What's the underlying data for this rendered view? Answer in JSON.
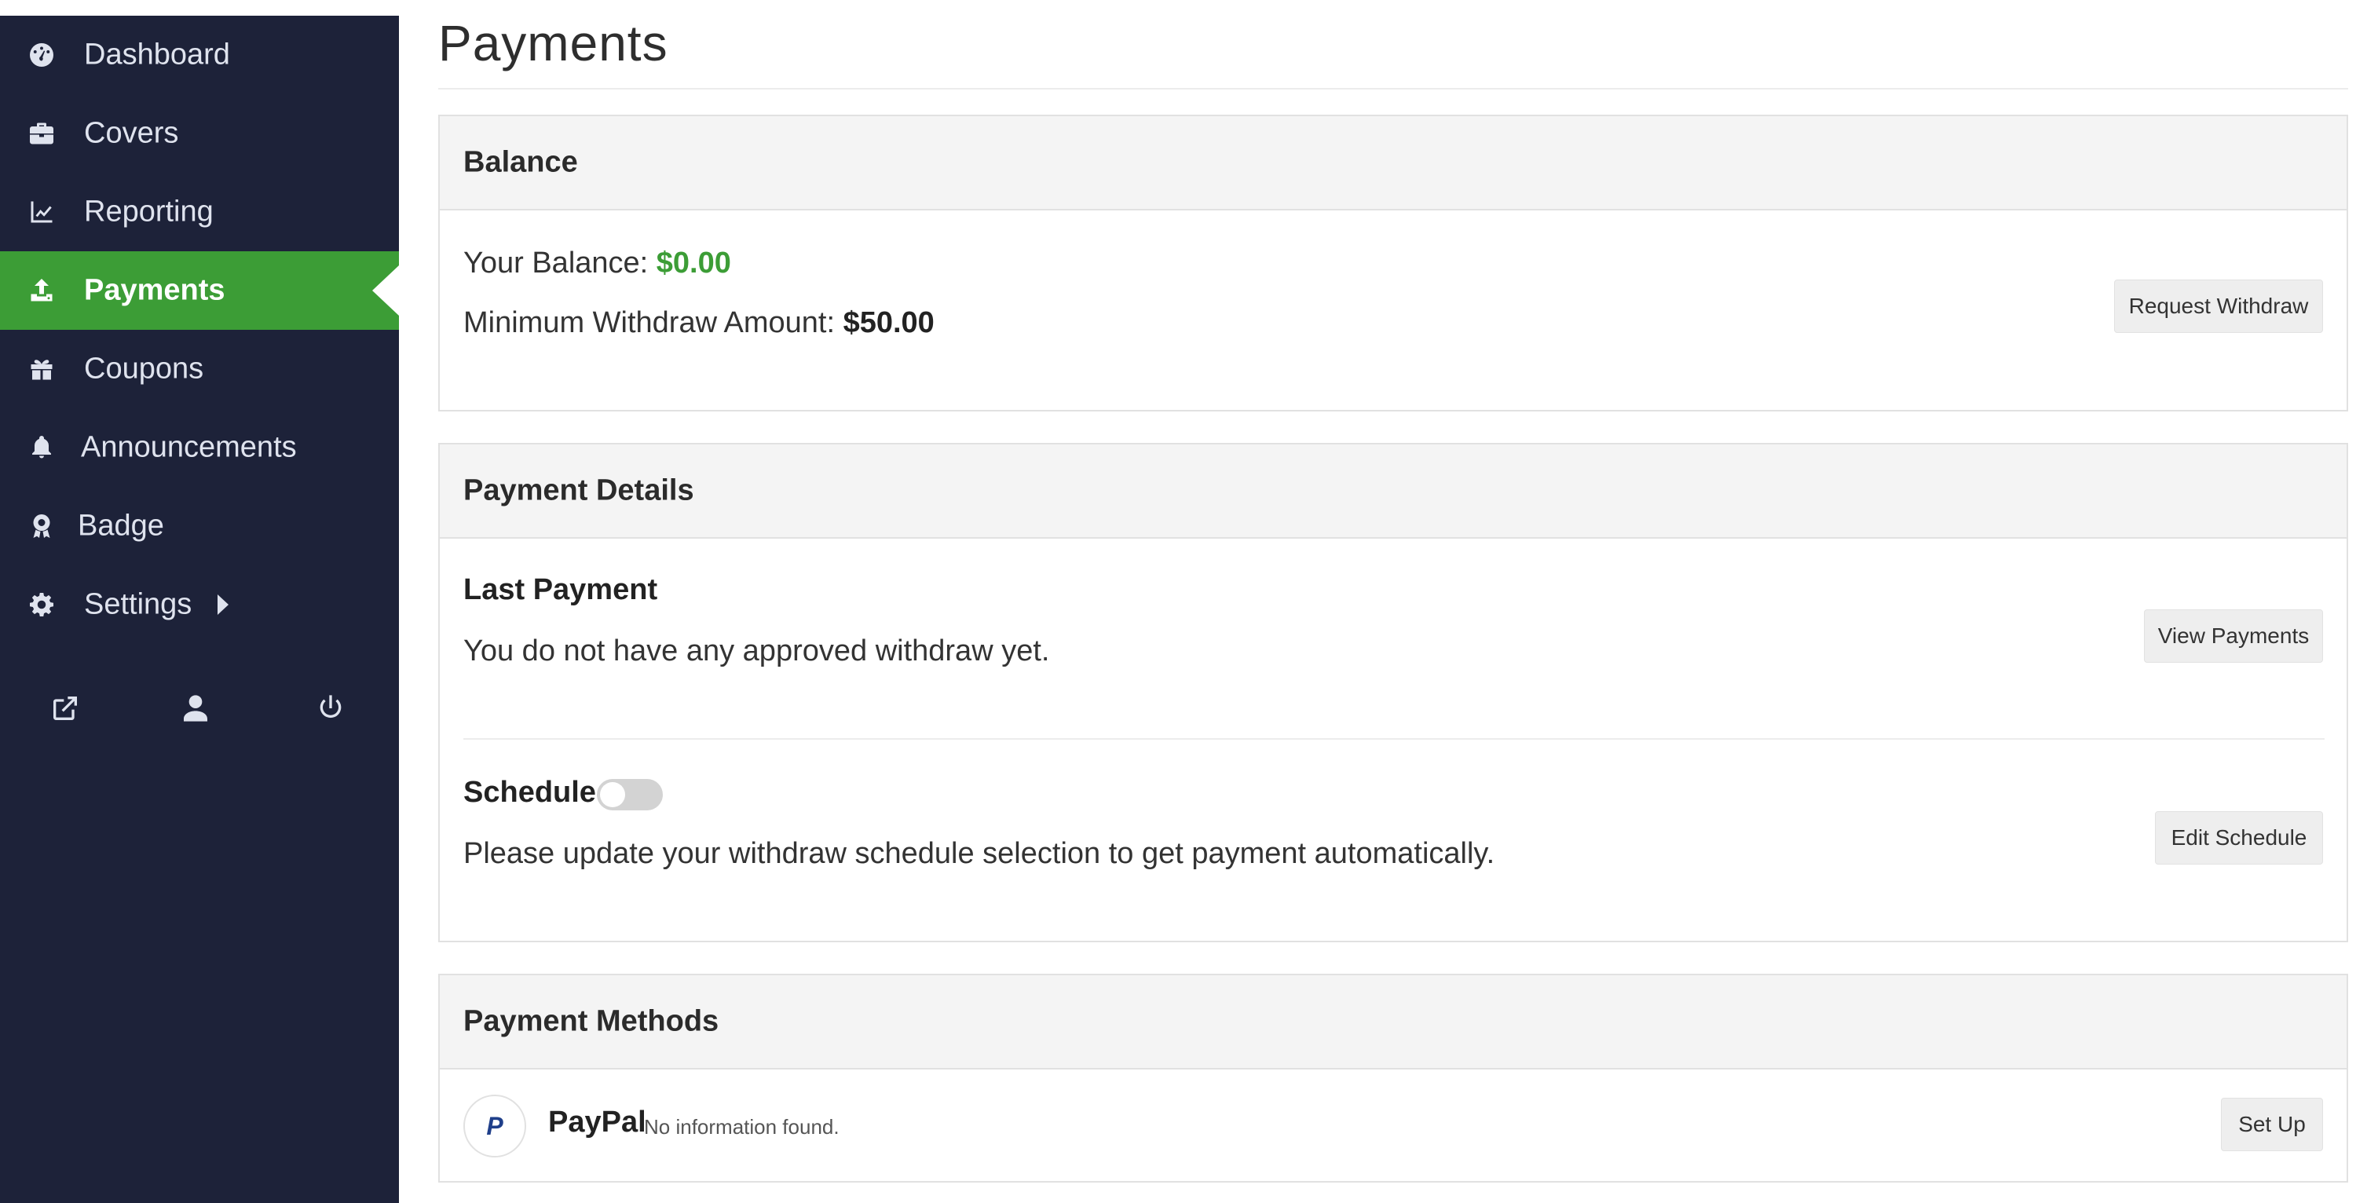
{
  "sidebar": {
    "items": [
      {
        "label": "Dashboard",
        "icon": "dashboard-icon"
      },
      {
        "label": "Covers",
        "icon": "briefcase-icon"
      },
      {
        "label": "Reporting",
        "icon": "line-chart-icon"
      },
      {
        "label": "Payments",
        "icon": "upload-icon",
        "active": true
      },
      {
        "label": "Coupons",
        "icon": "gift-icon"
      },
      {
        "label": "Announcements",
        "icon": "bell-icon"
      },
      {
        "label": "Badge",
        "icon": "award-icon"
      },
      {
        "label": "Settings",
        "icon": "gear-icon"
      }
    ],
    "bottom_icons": [
      "external-link-icon",
      "user-icon",
      "power-icon"
    ],
    "colors": {
      "background": "#1d2239",
      "active": "#3c9d36"
    }
  },
  "page": {
    "title": "Payments"
  },
  "balance": {
    "header": "Balance",
    "balance_label": "Your Balance:",
    "balance_value": "$0.00",
    "min_label": "Minimum Withdraw Amount:",
    "min_value": "$50.00",
    "button": "Request Withdraw"
  },
  "payment_details": {
    "header": "Payment Details",
    "last_payment_title": "Last Payment",
    "last_payment_text": "You do not have any approved withdraw yet.",
    "view_button": "View Payments",
    "schedule_title": "Schedule",
    "schedule_enabled": false,
    "schedule_text": "Please update your withdraw schedule selection to get payment automatically.",
    "edit_button": "Edit Schedule"
  },
  "payment_methods": {
    "header": "Payment Methods",
    "methods": [
      {
        "name": "PayPal",
        "logo": "P",
        "note": "No information found.",
        "button": "Set Up"
      }
    ]
  }
}
